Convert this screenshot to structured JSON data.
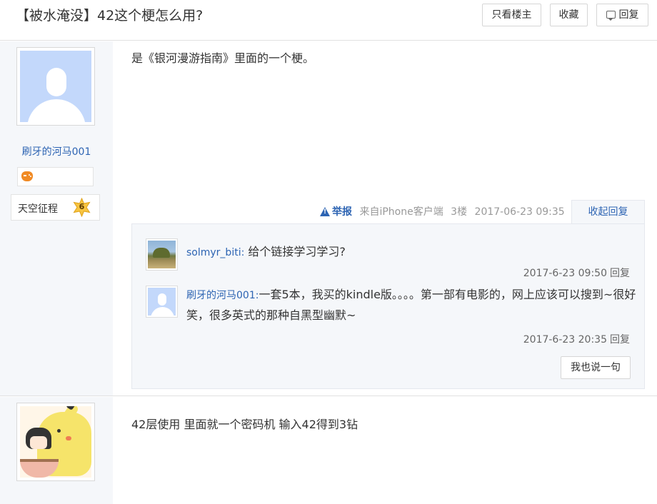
{
  "thread": {
    "title": "【被水淹没】42这个梗怎么用?",
    "buttons": {
      "only_op": "只看楼主",
      "favorite": "收藏",
      "reply": "回复"
    }
  },
  "post1": {
    "user": {
      "name": "刷牙的河马001",
      "level_name": "天空征程",
      "level": "6"
    },
    "content": "是《银河漫游指南》里面的一个梗。",
    "meta": {
      "report": "举报",
      "source": "来自iPhone客户端",
      "floor": "3楼",
      "time": "2017-06-23 09:35",
      "collapse": "收起回复"
    },
    "comments": [
      {
        "user": "solmyr_biti:",
        "text": "给个链接学习学习?",
        "time": "2017-6-23 09:50",
        "reply": "回复"
      },
      {
        "user": "刷牙的河马001:",
        "text": "一套5本，我买的kindle版。。。。第一部有电影的，网上应该可以搜到~很好笑，很多英式的那种自黑型幽默~",
        "time": "2017-6-23 20:35",
        "reply": "回复"
      }
    ],
    "say_button": "我也说一句"
  },
  "post2": {
    "content": "42层使用 里面就一个密码机 输入42得到3钻"
  },
  "colors": {
    "link": "#2d64b3",
    "sidebar_bg": "#f5f7fa",
    "avatar_default": "#c3d8fb",
    "badge_orange": "#f08a24"
  }
}
